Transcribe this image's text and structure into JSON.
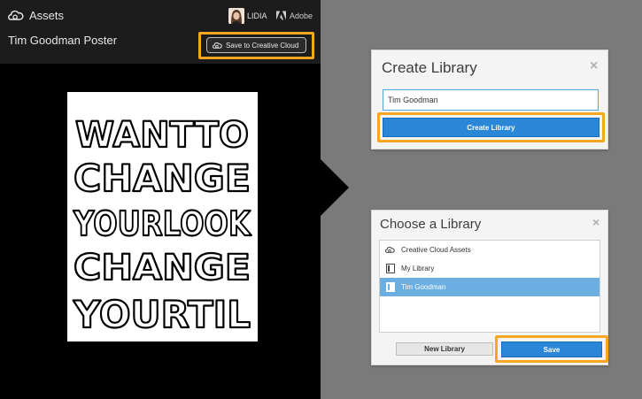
{
  "app": {
    "title": "Assets"
  },
  "user": {
    "name": "LIDIA"
  },
  "brand": {
    "label": "Adobe"
  },
  "document": {
    "title": "Tim Goodman Poster"
  },
  "toolbar": {
    "save_to_cc_label": "Save to Creative Cloud"
  },
  "poster": {
    "lines": [
      "WANTTO",
      "CHANGE",
      "YOURLOOK",
      "CHANGE",
      "YOURTIL"
    ]
  },
  "create_dialog": {
    "title": "Create Library",
    "input_value": "Tim Goodman",
    "button_label": "Create Library",
    "close": "×"
  },
  "choose_dialog": {
    "title": "Choose a Library",
    "close": "×",
    "items": [
      {
        "label": "Creative Cloud Assets",
        "icon": "creative-cloud-icon"
      },
      {
        "label": "My Library",
        "icon": "library-icon"
      },
      {
        "label": "Tim Goodman",
        "icon": "library-icon",
        "selected": true
      }
    ],
    "new_library_label": "New Library",
    "save_label": "Save"
  },
  "colors": {
    "highlight": "#f5a623",
    "primary_button": "#2a86d6",
    "selected_row": "#6aaee2",
    "panel_bg": "#000000",
    "workspace_bg": "#7a7a7a"
  }
}
